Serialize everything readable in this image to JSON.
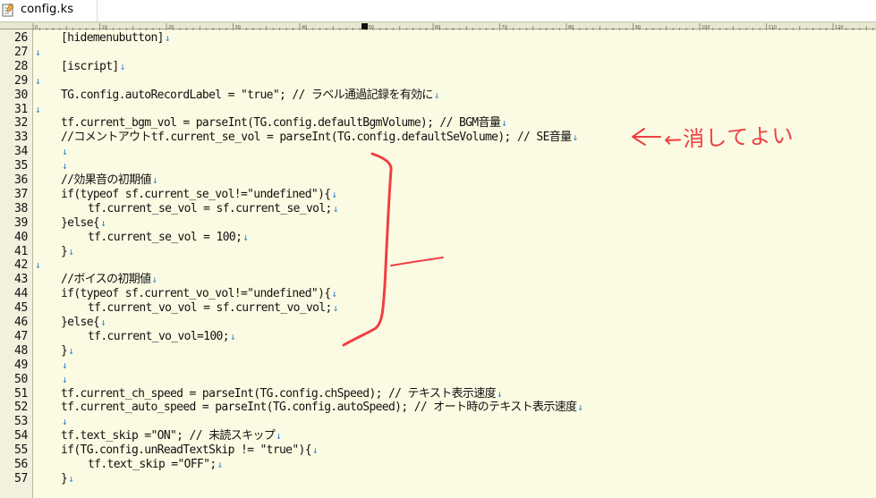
{
  "tab": {
    "filename": "config.ks",
    "icon": "notepad-file-icon"
  },
  "colors": {
    "editor_bg": "#fbfbe3",
    "gutter_bg": "#f1f1de",
    "eol_marker": "#2f7fd6",
    "annotation": "#ef3f42"
  },
  "ruler": {
    "labels": [
      "0",
      "10",
      "20",
      "30",
      "40",
      "50",
      "60",
      "70",
      "80",
      "90",
      "100",
      "110",
      "120"
    ]
  },
  "eol_marker": "↓",
  "lines": [
    {
      "num": "26",
      "indent": 1,
      "text": "[hidemenubutton]"
    },
    {
      "num": "27",
      "indent": 0,
      "text": ""
    },
    {
      "num": "28",
      "indent": 1,
      "text": "[iscript]"
    },
    {
      "num": "29",
      "indent": 0,
      "text": ""
    },
    {
      "num": "30",
      "indent": 1,
      "text": "TG.config.autoRecordLabel = \"true\"; // ラベル通過記録を有効に"
    },
    {
      "num": "31",
      "indent": 0,
      "text": ""
    },
    {
      "num": "32",
      "indent": 1,
      "text": "tf.current_bgm_vol = parseInt(TG.config.defaultBgmVolume); // BGM音量"
    },
    {
      "num": "33",
      "indent": 1,
      "text": "//コメントアウトtf.current_se_vol = parseInt(TG.config.defaultSeVolume); // SE音量"
    },
    {
      "num": "34",
      "indent": 1,
      "text": ""
    },
    {
      "num": "35",
      "indent": 1,
      "text": ""
    },
    {
      "num": "36",
      "indent": 1,
      "text": "//効果音の初期値"
    },
    {
      "num": "37",
      "indent": 1,
      "text": "if(typeof sf.current_se_vol!=\"undefined\"){"
    },
    {
      "num": "38",
      "indent": 2,
      "text": "tf.current_se_vol = sf.current_se_vol;"
    },
    {
      "num": "39",
      "indent": 1,
      "text": "}else{"
    },
    {
      "num": "40",
      "indent": 2,
      "text": "tf.current_se_vol = 100;"
    },
    {
      "num": "41",
      "indent": 1,
      "text": "}"
    },
    {
      "num": "42",
      "indent": 0,
      "text": ""
    },
    {
      "num": "43",
      "indent": 1,
      "text": "//ボイスの初期値"
    },
    {
      "num": "44",
      "indent": 1,
      "text": "if(typeof sf.current_vo_vol!=\"undefined\"){"
    },
    {
      "num": "45",
      "indent": 2,
      "text": "tf.current_vo_vol = sf.current_vo_vol;"
    },
    {
      "num": "46",
      "indent": 1,
      "text": "}else{"
    },
    {
      "num": "47",
      "indent": 2,
      "text": "tf.current_vo_vol=100;"
    },
    {
      "num": "48",
      "indent": 1,
      "text": "}"
    },
    {
      "num": "49",
      "indent": 1,
      "text": ""
    },
    {
      "num": "50",
      "indent": 1,
      "text": ""
    },
    {
      "num": "51",
      "indent": 1,
      "text": "tf.current_ch_speed = parseInt(TG.config.chSpeed); // テキスト表示速度"
    },
    {
      "num": "52",
      "indent": 1,
      "text": "tf.current_auto_speed = parseInt(TG.config.autoSpeed); // オート時のテキスト表示速度"
    },
    {
      "num": "53",
      "indent": 1,
      "text": ""
    },
    {
      "num": "54",
      "indent": 1,
      "text": "tf.text_skip =\"ON\"; // 未読スキップ"
    },
    {
      "num": "55",
      "indent": 1,
      "text": "if(TG.config.unReadTextSkip != \"true\"){"
    },
    {
      "num": "56",
      "indent": 2,
      "text": "tf.text_skip =\"OFF\";"
    },
    {
      "num": "57",
      "indent": 1,
      "text": "}"
    }
  ],
  "annotation": {
    "note": "←消してよい"
  }
}
